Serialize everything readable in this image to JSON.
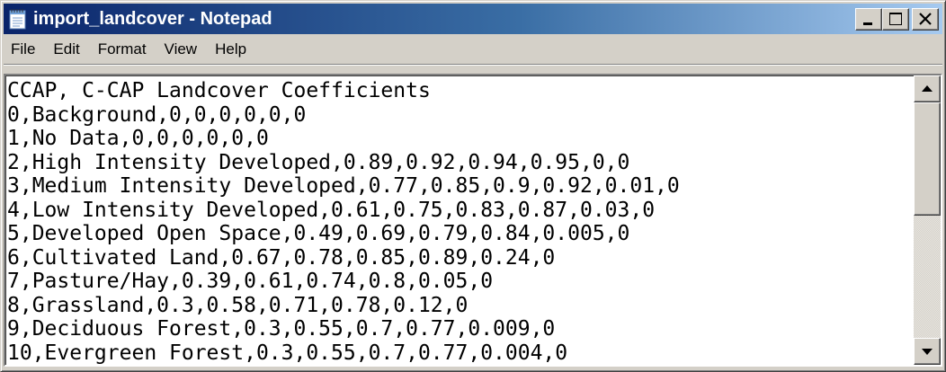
{
  "window": {
    "title": "import_landcover - Notepad",
    "app_icon": "notepad-icon"
  },
  "title_buttons": {
    "minimize_icon": "minimize-icon",
    "maximize_icon": "maximize-icon",
    "close_icon": "close-icon"
  },
  "menu": {
    "items": [
      "File",
      "Edit",
      "Format",
      "View",
      "Help"
    ]
  },
  "document": {
    "lines": [
      "CCAP, C-CAP Landcover Coefficients",
      "0,Background,0,0,0,0,0,0",
      "1,No Data,0,0,0,0,0,0",
      "2,High Intensity Developed,0.89,0.92,0.94,0.95,0,0",
      "3,Medium Intensity Developed,0.77,0.85,0.9,0.92,0.01,0",
      "4,Low Intensity Developed,0.61,0.75,0.83,0.87,0.03,0",
      "5,Developed Open Space,0.49,0.69,0.79,0.84,0.005,0",
      "6,Cultivated Land,0.67,0.78,0.85,0.89,0.24,0",
      "7,Pasture/Hay,0.39,0.61,0.74,0.8,0.05,0",
      "8,Grassland,0.3,0.58,0.71,0.78,0.12,0",
      "9,Deciduous Forest,0.3,0.55,0.7,0.77,0.009,0",
      "10,Evergreen Forest,0.3,0.55,0.7,0.77,0.004,0"
    ]
  },
  "scrollbar": {
    "up_icon": "scroll-up-arrow-icon",
    "down_icon": "scroll-down-arrow-icon"
  },
  "colors": {
    "titlebar_start": "#0a246a",
    "titlebar_end": "#a6caf0",
    "chrome": "#d4d0c8"
  }
}
